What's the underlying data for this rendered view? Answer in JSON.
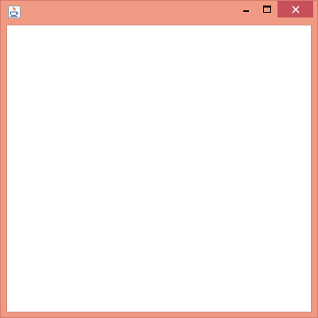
{
  "window": {
    "title": "",
    "frame_color": "#f09a84",
    "close_button_color": "#c7505a",
    "client_background": "#ffffff"
  },
  "titlebar": {
    "app_icon": "java-coffee-cup-icon",
    "controls": {
      "minimize_icon": "minimize-icon",
      "maximize_icon": "maximize-icon",
      "close_icon": "close-icon"
    }
  }
}
